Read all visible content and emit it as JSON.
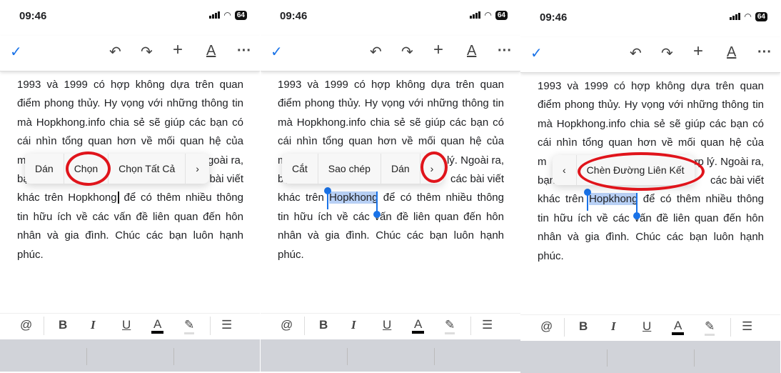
{
  "status": {
    "time": "09:46",
    "battery": "64"
  },
  "toolbar": {
    "icons": [
      "check-icon",
      "undo-icon",
      "redo-icon",
      "plus-icon",
      "text-format-icon",
      "more-icon"
    ]
  },
  "doc": {
    "lines": [
      "1993 và 1999 có hợp không dựa trên quan",
      "điểm phong thủy. Hy vọng với những thông tin",
      "mà Hopkhong.info chia sẻ sẽ giúp các bạn có",
      "cái nhìn tổng quan hơn về mối quan hệ của"
    ],
    "line5": {
      "left": "m",
      "right": "hợp lý. Ngoài ra,"
    },
    "line6": {
      "left": "bạn",
      "right": "các bài viết"
    },
    "line7": {
      "before": "khác trên ",
      "word": "Hopkhong",
      "after": " để có thêm nhiều thông"
    },
    "tail": [
      "tin hữu ích về các vấn đề liên quan đến hôn",
      "nhân và gia đình. Chúc các bạn luôn hạnh",
      "phúc."
    ]
  },
  "menus": [
    {
      "items": [
        "Dán",
        "Chọn",
        "Chọn Tất Cả",
        "›"
      ],
      "highlighted": "Chọn"
    },
    {
      "items": [
        "Cắt",
        "Sao chép",
        "Dán",
        "›"
      ],
      "highlighted": "›"
    },
    {
      "items": [
        "‹",
        "Chèn Đường Liên Kết"
      ],
      "highlighted": "Chèn Đường Liên Kết"
    }
  ],
  "format_bar": {
    "icons": [
      "mention-icon",
      "bold-icon",
      "italic-icon",
      "underline-icon",
      "text-color-icon",
      "highlight-icon",
      "list-icon"
    ]
  },
  "colors": {
    "accent": "#1a73e8",
    "annotation": "#e0141b",
    "selection": "#b8d0f5"
  }
}
